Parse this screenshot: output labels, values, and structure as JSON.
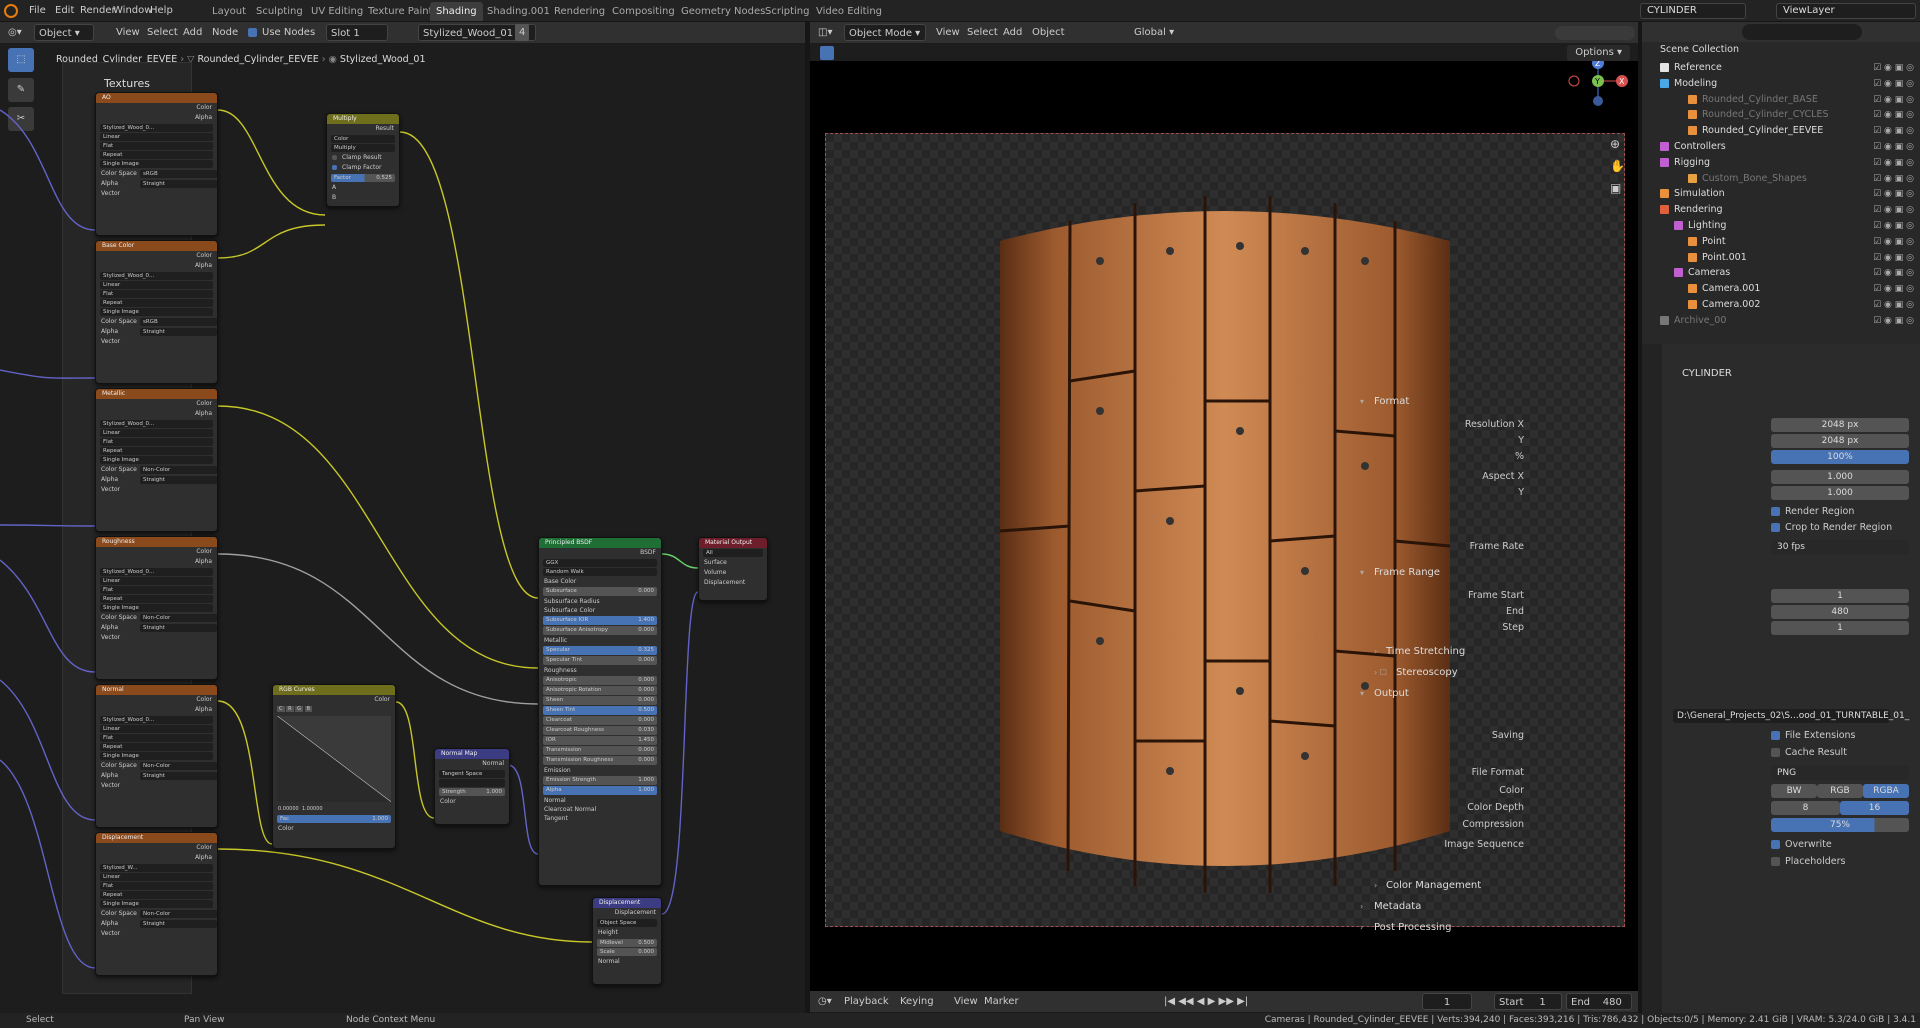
{
  "app": {
    "menu": [
      "File",
      "Edit",
      "Render",
      "Window",
      "Help"
    ],
    "workspaces": [
      "Layout",
      "Sculpting",
      "UV Editing",
      "Texture Paint",
      "Shading",
      "Shading.001",
      "Rendering",
      "Compositing",
      "Geometry Nodes",
      "Scripting",
      "Video Editing"
    ],
    "active_workspace": "Shading",
    "scene": "CYLINDER",
    "view_layer": "ViewLayer"
  },
  "node_editor": {
    "header": {
      "object_mode": "Object",
      "menus": [
        "View",
        "Select",
        "Add",
        "Node"
      ],
      "use_nodes": "Use Nodes",
      "slot": "Slot 1",
      "material": "Stylized_Wood_01",
      "users": "4"
    },
    "breadcrumb": [
      "Rounded_Cylinder_EEVEE",
      "Rounded_Cylinder_EEVEE",
      "Stylized_Wood_01"
    ],
    "frame_label": "Textures",
    "texture_nodes": [
      {
        "title": "AO",
        "image": "Stylized_Wood_0...",
        "interp": "Linear",
        "proj": "Flat",
        "ext": "Repeat",
        "src": "Single Image",
        "cs_label": "Color Space",
        "cs": "sRGB",
        "alpha_label": "Alpha",
        "alpha": "Straight"
      },
      {
        "title": "Base Color",
        "image": "Stylized_Wood_0...",
        "interp": "Linear",
        "proj": "Flat",
        "ext": "Repeat",
        "src": "Single Image",
        "cs_label": "Color Space",
        "cs": "sRGB",
        "alpha_label": "Alpha",
        "alpha": "Straight"
      },
      {
        "title": "Metallic",
        "image": "Stylized_Wood_0...",
        "interp": "Linear",
        "proj": "Flat",
        "ext": "Repeat",
        "src": "Single Image",
        "cs_label": "Color Space",
        "cs": "Non-Color",
        "alpha_label": "Alpha",
        "alpha": "Straight"
      },
      {
        "title": "Roughness",
        "image": "Stylized_Wood_0...",
        "interp": "Linear",
        "proj": "Flat",
        "ext": "Repeat",
        "src": "Single Image",
        "cs_label": "Color Space",
        "cs": "Non-Color",
        "alpha_label": "Alpha",
        "alpha": "Straight"
      },
      {
        "title": "Normal",
        "image": "Stylized_Wood_0...",
        "interp": "Linear",
        "proj": "Flat",
        "ext": "Repeat",
        "src": "Single Image",
        "cs_label": "Color Space",
        "cs": "Non-Color",
        "alpha_label": "Alpha",
        "alpha": "Straight"
      },
      {
        "title": "Displacement",
        "image": "Stylized_W...",
        "interp": "Linear",
        "proj": "Flat",
        "ext": "Repeat",
        "src": "Single Image",
        "cs_label": "Color Space",
        "cs": "Non-Color",
        "alpha_label": "Alpha",
        "alpha": "Straight"
      }
    ],
    "socket_labels": {
      "color": "Color",
      "alpha": "Alpha",
      "vector": "Vector"
    },
    "multiply": {
      "title": "Multiply",
      "result": "Result",
      "type": "Color",
      "op": "Multiply",
      "clamp_result": "Clamp Result",
      "clamp_factor": "Clamp Factor",
      "factor_label": "Factor",
      "factor": "0.525",
      "a": "A",
      "b": "B"
    },
    "rgb_curves": {
      "title": "RGB Curves",
      "color_out": "Color",
      "channels": [
        "C",
        "R",
        "G",
        "B"
      ],
      "x": "0.00000",
      "y": "1.00000",
      "fac_label": "Fac",
      "fac": "1.000",
      "color_in": "Color"
    },
    "normal_map": {
      "title": "Normal Map",
      "out": "Normal",
      "space": "Tangent Space",
      "strength_label": "Strength",
      "strength": "1.000",
      "color_in": "Color"
    },
    "principled": {
      "title": "Principled BSDF",
      "out": "BSDF",
      "dist": "GGX",
      "sss": "Random Walk",
      "rows": [
        [
          "Base Color",
          ""
        ],
        [
          "Subsurface",
          "0.000"
        ],
        [
          "Subsurface Radius",
          ""
        ],
        [
          "Subsurface Color",
          ""
        ],
        [
          "Subsurface IOR",
          "1.400"
        ],
        [
          "Subsurface Anisotropy",
          "0.000"
        ],
        [
          "Metallic",
          ""
        ],
        [
          "Specular",
          "0.325"
        ],
        [
          "Specular Tint",
          "0.000"
        ],
        [
          "Roughness",
          ""
        ],
        [
          "Anisotropic",
          "0.000"
        ],
        [
          "Anisotropic Rotation",
          "0.000"
        ],
        [
          "Sheen",
          "0.000"
        ],
        [
          "Sheen Tint",
          "0.500"
        ],
        [
          "Clearcoat",
          "0.000"
        ],
        [
          "Clearcoat Roughness",
          "0.030"
        ],
        [
          "IOR",
          "1.450"
        ],
        [
          "Transmission",
          "0.000"
        ],
        [
          "Transmission Roughness",
          "0.000"
        ],
        [
          "Emission",
          ""
        ],
        [
          "Emission Strength",
          "1.000"
        ],
        [
          "Alpha",
          "1.000"
        ],
        [
          "Normal",
          ""
        ],
        [
          "Clearcoat Normal",
          ""
        ],
        [
          "Tangent",
          ""
        ]
      ]
    },
    "material_output": {
      "title": "Material Output",
      "target": "All",
      "inputs": [
        "Surface",
        "Volume",
        "Displacement"
      ]
    },
    "displacement": {
      "title": "Displacement",
      "out": "Displacement",
      "space": "Object Space",
      "height": "Height",
      "midlevel_label": "Midlevel",
      "midlevel": "0.500",
      "scale_label": "Scale",
      "scale": "0.000",
      "normal": "Normal"
    }
  },
  "viewport": {
    "mode": "Object Mode",
    "menus": [
      "View",
      "Select",
      "Add",
      "Object"
    ],
    "orientation": "Global",
    "options": "Options",
    "axes": {
      "x": "X",
      "y": "Y",
      "z": "Z"
    }
  },
  "timeline": {
    "menus": [
      "Playback",
      "Keying",
      "View",
      "Marker"
    ],
    "current": "1",
    "start_label": "Start",
    "start": "1",
    "end_label": "End",
    "end": "480"
  },
  "outliner": {
    "title": "Scene Collection",
    "rows": [
      {
        "label": "Reference",
        "color": "#e4e4e4",
        "indent": 0,
        "dim": false
      },
      {
        "label": "Modeling",
        "color": "#4aa8e8",
        "indent": 0,
        "dim": false
      },
      {
        "label": "Rounded_Cylinder_BASE",
        "color": "#e8903c",
        "indent": 2,
        "dim": true
      },
      {
        "label": "Rounded_Cylinder_CYCLES",
        "color": "#e8903c",
        "indent": 2,
        "dim": true
      },
      {
        "label": "Rounded_Cylinder_EEVEE",
        "color": "#e8903c",
        "indent": 2,
        "dim": false
      },
      {
        "label": "Controllers",
        "color": "#c060d0",
        "indent": 0,
        "dim": false
      },
      {
        "label": "Rigging",
        "color": "#c060d0",
        "indent": 0,
        "dim": false
      },
      {
        "label": "Custom_Bone_Shapes",
        "color": "#e8a040",
        "indent": 2,
        "dim": true
      },
      {
        "label": "Simulation",
        "color": "#e8903c",
        "indent": 0,
        "dim": false
      },
      {
        "label": "Rendering",
        "color": "#e0603c",
        "indent": 0,
        "dim": false
      },
      {
        "label": "Lighting",
        "color": "#c060d0",
        "indent": 1,
        "dim": false
      },
      {
        "label": "Point",
        "color": "#e8903c",
        "indent": 2,
        "dim": false
      },
      {
        "label": "Point.001",
        "color": "#e8903c",
        "indent": 2,
        "dim": false
      },
      {
        "label": "Cameras",
        "color": "#c060d0",
        "indent": 1,
        "dim": false
      },
      {
        "label": "Camera.001",
        "color": "#e8903c",
        "indent": 2,
        "dim": false
      },
      {
        "label": "Camera.002",
        "color": "#e8903c",
        "indent": 2,
        "dim": false
      },
      {
        "label": "Archive_00",
        "color": "#777777",
        "indent": 0,
        "dim": true
      }
    ]
  },
  "properties": {
    "object": "CYLINDER",
    "format_label": "Format",
    "res_x_label": "Resolution X",
    "res_x": "2048 px",
    "res_y_label": "Y",
    "res_y": "2048 px",
    "pct_label": "%",
    "pct": "100%",
    "aspect_x_label": "Aspect X",
    "aspect_x": "1.000",
    "aspect_y_label": "Y",
    "aspect_y": "1.000",
    "render_region": "Render Region",
    "crop": "Crop to Render Region",
    "fps_label": "Frame Rate",
    "fps": "30 fps",
    "frame_range_label": "Frame Range",
    "fs_label": "Frame Start",
    "fs": "1",
    "fe_label": "End",
    "fe": "480",
    "step_label": "Step",
    "step": "1",
    "time_stretching": "Time Stretching",
    "stereoscopy": "Stereoscopy",
    "output_label": "Output",
    "path": "D:\\General_Projects_02\\S...ood_01_TURNTABLE_01_",
    "saving_label": "Saving",
    "file_ext": "File Extensions",
    "cache": "Cache Result",
    "ff_label": "File Format",
    "ff": "PNG",
    "color_label": "Color",
    "color_opts": [
      "BW",
      "RGB",
      "RGBA"
    ],
    "depth_label": "Color Depth",
    "depth_opts": [
      "8",
      "16"
    ],
    "comp_label": "Compression",
    "comp": "75%",
    "seq_label": "Image Sequence",
    "overwrite": "Overwrite",
    "placeholders": "Placeholders",
    "color_mgmt": "Color Management",
    "metadata": "Metadata",
    "post": "Post Processing"
  },
  "status": {
    "left": [
      "Select",
      "Pan View",
      "Node Context Menu"
    ],
    "right": "Cameras | Rounded_Cylinder_EEVEE | Verts:394,240 | Faces:393,216 | Tris:786,432 | Objects:0/5 | Memory: 2.41 GiB | VRAM: 5.3/24.0 GiB | 3.4.1"
  }
}
